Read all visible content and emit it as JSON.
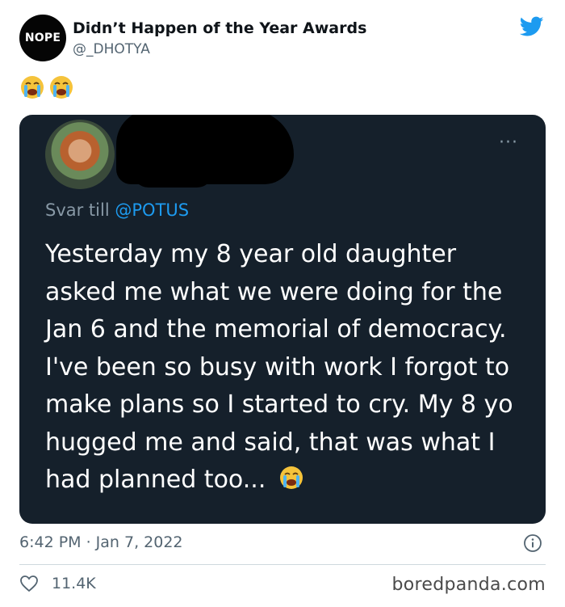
{
  "account": {
    "avatar_text": "NOPE",
    "display_name": "Didn’t Happen of the Year Awards",
    "handle": "@_DHOTYA",
    "platform_icon": "twitter-bird-icon",
    "accent_color": "#1d9bf0"
  },
  "intro_emojis": [
    "loudly-crying-face-icon",
    "loudly-crying-face-icon"
  ],
  "quoted_tweet": {
    "background_color": "#15202b",
    "more_label": "···",
    "reply_prefix": "Svar till",
    "reply_mention": "@POTUS",
    "text": "Yesterday my 8 year old daughter asked me what we were doing for the Jan 6 and the memorial of democracy. I've been so busy with work I forgot to make plans so I started to cry. My 8 yo hugged me and said, that was what I had planned too...",
    "trailing_emoji": "loudly-crying-face-icon"
  },
  "footer": {
    "timestamp": "6:42 PM · Jan 7, 2022",
    "like_count": "11.4K",
    "watermark": "boredpanda.com"
  }
}
